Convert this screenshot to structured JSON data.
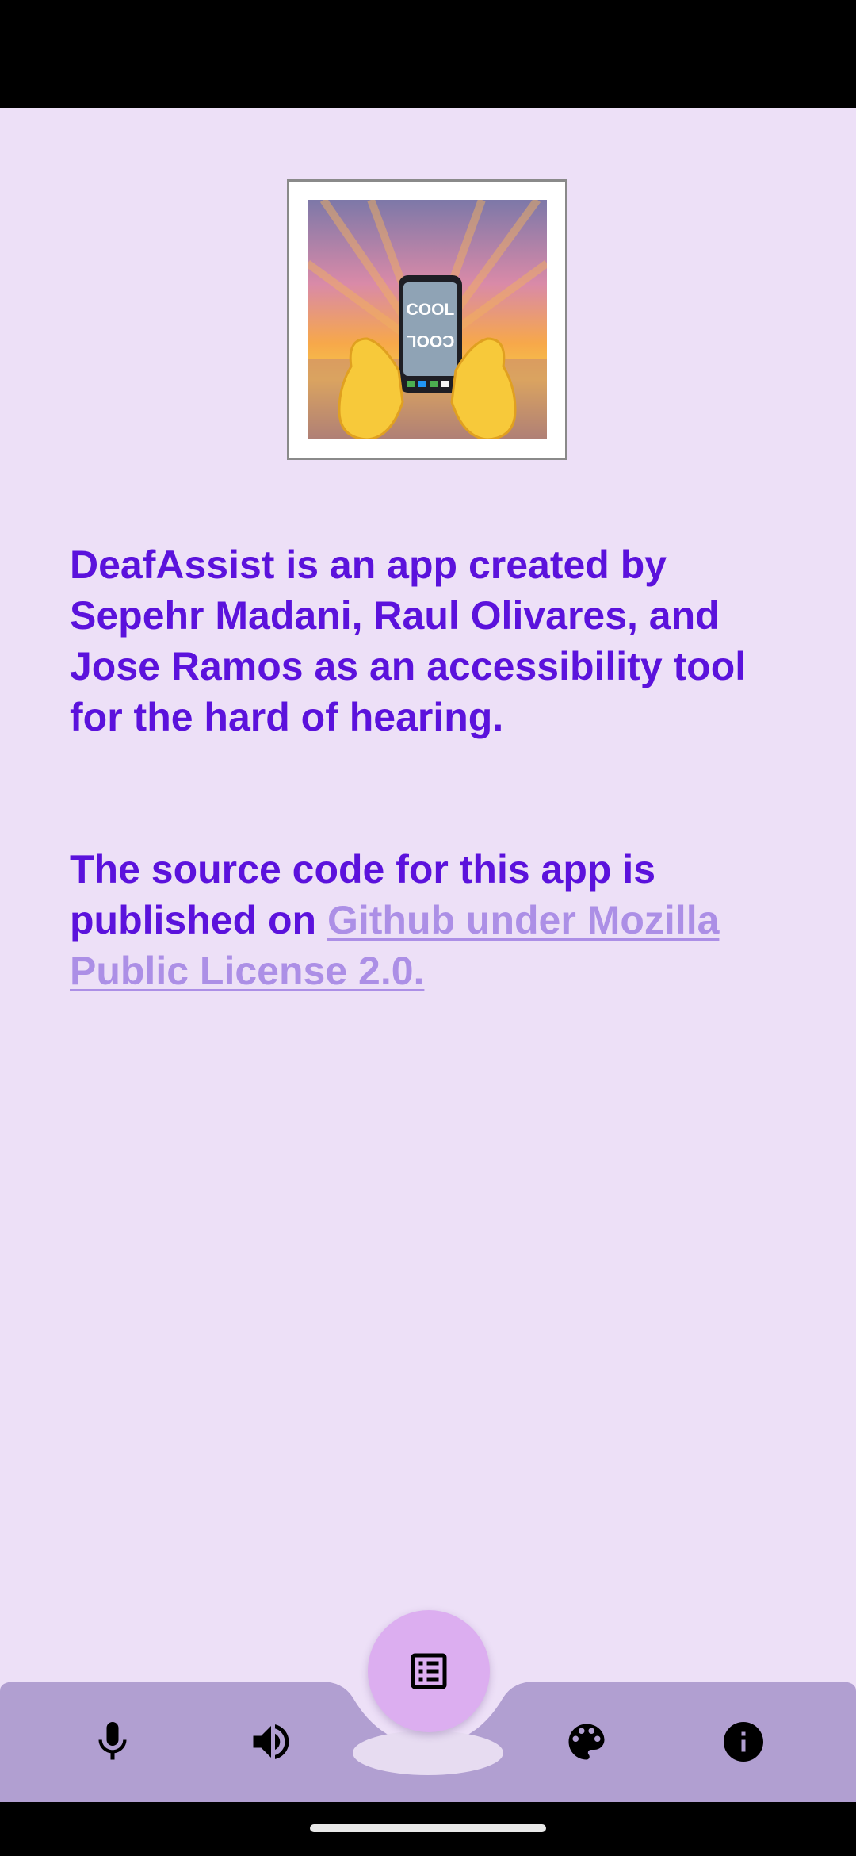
{
  "about": {
    "description": "DeafAssist is an app created by Sepehr Madani, Raul Olivares, and Jose Ramos as an accessibility tool for the hard of hearing.",
    "source_prefix": " The source code for this app is published on ",
    "source_link": "Github under Mozilla Public License 2.0."
  },
  "logo": {
    "icon": "cool-phone-in-hands-emoji",
    "screen_text_top": "COOL",
    "screen_text_bottom": "COOL"
  },
  "bottom_nav": {
    "items": [
      {
        "icon": "microphone-icon"
      },
      {
        "icon": "speaker-icon"
      },
      {
        "icon": "palette-icon"
      },
      {
        "icon": "info-icon"
      }
    ],
    "fab_icon": "list-icon"
  },
  "colors": {
    "background": "#ede0f7",
    "text_primary": "#5b12dc",
    "link": "#ac8fe6",
    "bottom_bar": "#b19fd1",
    "fab": "#dcaef0"
  }
}
